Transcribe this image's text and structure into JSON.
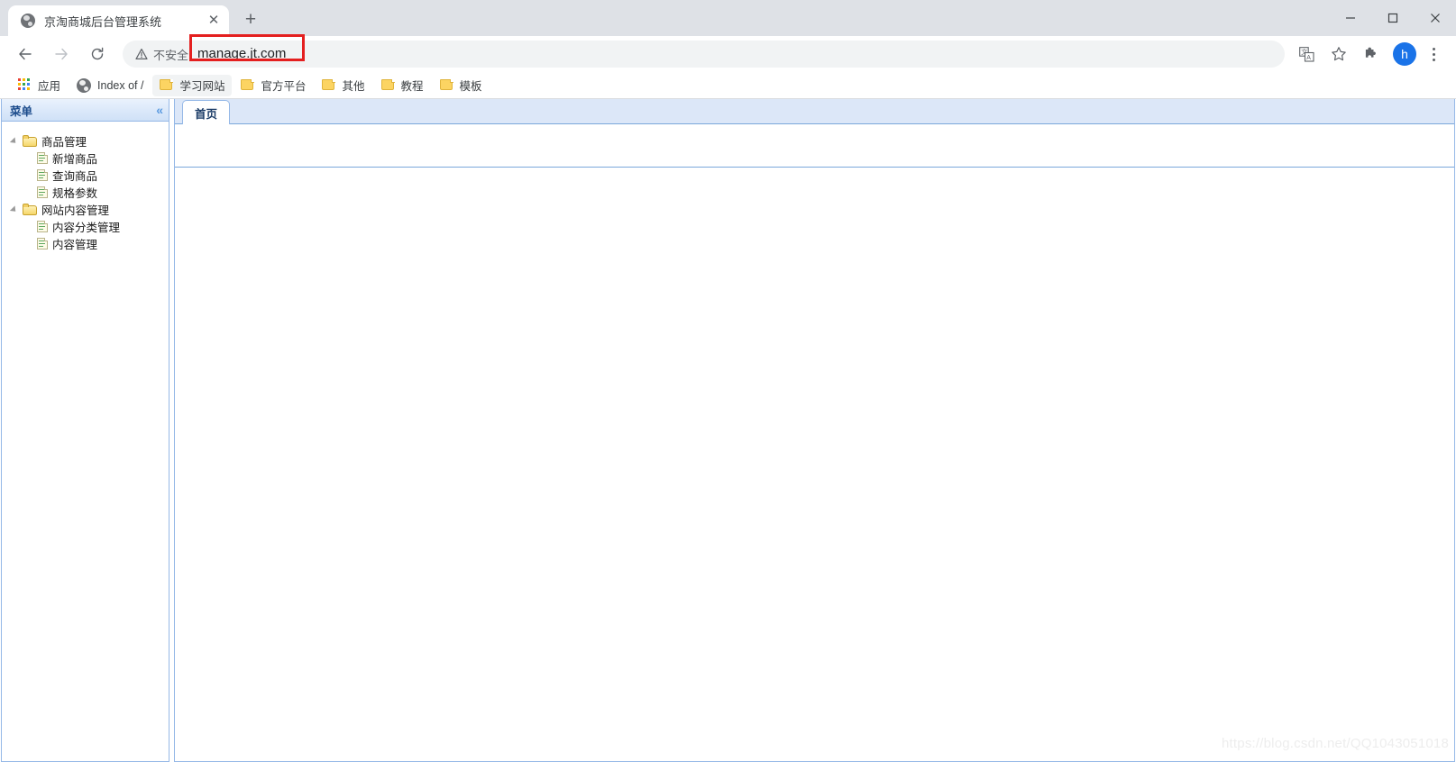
{
  "browser": {
    "tab": {
      "title": "京淘商城后台管理系统",
      "favicon": "globe-icon",
      "close_label": "✕"
    },
    "new_tab_label": "+",
    "window_controls": {
      "minimize": "minimize-icon",
      "maximize": "maximize-icon",
      "close": "close-icon"
    },
    "nav": {
      "back": "back-arrow-icon",
      "forward": "forward-arrow-icon",
      "reload": "reload-icon"
    },
    "omnibox": {
      "security_label": "不安全",
      "security_icon": "warning-triangle-icon",
      "url": "manage.jt.com",
      "annotation_color": "#e41f1f"
    },
    "toolbar_icons": {
      "translate": "translate-icon",
      "bookmark_star": "star-icon",
      "extensions": "puzzle-icon",
      "profile_initial": "h",
      "profile_color": "#1a73e8",
      "menu": "three-dots-icon"
    },
    "bookmarks": [
      {
        "label": "应用",
        "icon": "apps-grid-icon",
        "hovered": false
      },
      {
        "label": "Index of /",
        "icon": "globe-icon",
        "hovered": false
      },
      {
        "label": "学习网站",
        "icon": "folder-icon",
        "hovered": true
      },
      {
        "label": "官方平台",
        "icon": "folder-icon",
        "hovered": false
      },
      {
        "label": "其他",
        "icon": "folder-icon",
        "hovered": false
      },
      {
        "label": "教程",
        "icon": "folder-icon",
        "hovered": false
      },
      {
        "label": "模板",
        "icon": "folder-icon",
        "hovered": false
      }
    ]
  },
  "page": {
    "sidebar": {
      "title": "菜单",
      "collapse_icon": "«",
      "tree": [
        {
          "label": "商品管理",
          "type": "folder",
          "expanded": true
        },
        {
          "label": "新增商品",
          "type": "doc"
        },
        {
          "label": "查询商品",
          "type": "doc"
        },
        {
          "label": "规格参数",
          "type": "doc"
        },
        {
          "label": "网站内容管理",
          "type": "folder",
          "expanded": true
        },
        {
          "label": "内容分类管理",
          "type": "doc"
        },
        {
          "label": "内容管理",
          "type": "doc"
        }
      ]
    },
    "content": {
      "tabs": [
        {
          "label": "首页",
          "active": true
        }
      ]
    },
    "watermark": "https://blog.csdn.net/QQ1043051018"
  }
}
